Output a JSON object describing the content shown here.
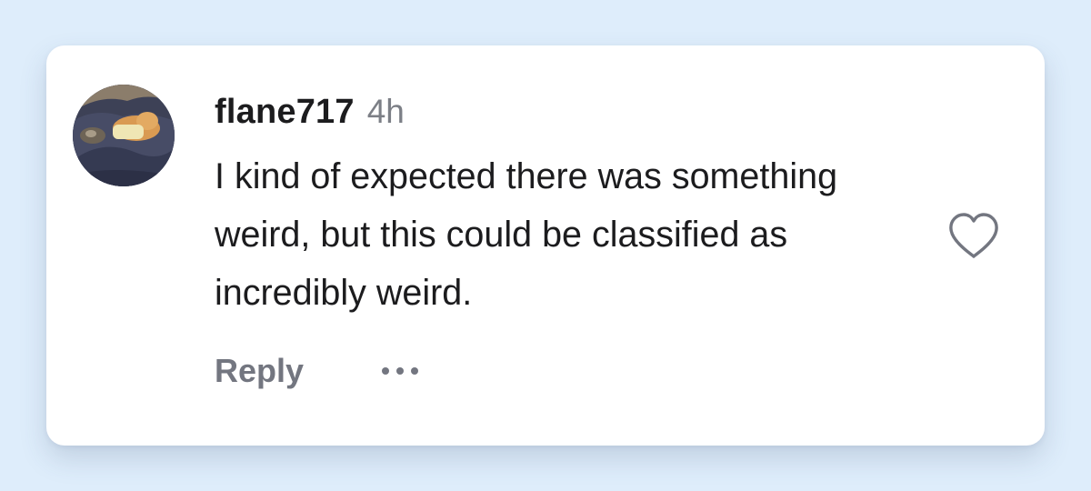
{
  "comment": {
    "username": "flane717",
    "timestamp": "4h",
    "text": "I kind of expected there was something weird, but this could be classified as incredibly weird.",
    "reply_label": "Reply",
    "more_label": "•••"
  },
  "icons": {
    "like": "heart-outline-icon",
    "more": "ellipsis-icon"
  },
  "colors": {
    "page_background": "#deedfb",
    "card_background": "#ffffff",
    "text_primary": "#1c1c1e",
    "text_secondary": "#737680"
  }
}
